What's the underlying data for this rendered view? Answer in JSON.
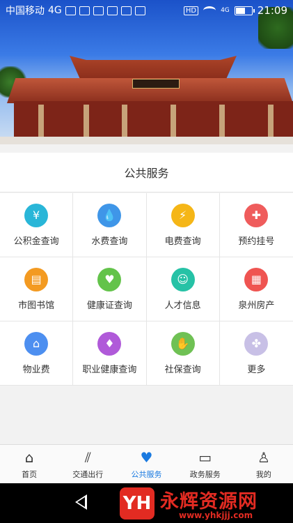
{
  "status_bar": {
    "carrier": "中国移动",
    "network": "4G",
    "hd": "HD",
    "signal_label": "4G",
    "time": "21:09"
  },
  "section": {
    "title": "公共服务"
  },
  "services": [
    {
      "label": "公积金查询",
      "icon": "house-yen-icon",
      "color": "#29b6d8",
      "glyph": "¥"
    },
    {
      "label": "水费查询",
      "icon": "water-drop-icon",
      "color": "#3f96e8",
      "glyph": "💧"
    },
    {
      "label": "电费查询",
      "icon": "lightning-icon",
      "color": "#f5b617",
      "glyph": "⚡"
    },
    {
      "label": "预约挂号",
      "icon": "doctor-icon",
      "color": "#ef5c5c",
      "glyph": "✚"
    },
    {
      "label": "市图书馆",
      "icon": "book-icon",
      "color": "#f39a21",
      "glyph": "▤"
    },
    {
      "label": "健康证查询",
      "icon": "heartbeat-icon",
      "color": "#63c34a",
      "glyph": "♥"
    },
    {
      "label": "人才信息",
      "icon": "people-icon",
      "color": "#26c2a6",
      "glyph": "☺"
    },
    {
      "label": "泉州房产",
      "icon": "building-icon",
      "color": "#ef5451",
      "glyph": "▦"
    },
    {
      "label": "物业费",
      "icon": "house-smile-icon",
      "color": "#4d8ff0",
      "glyph": "⌂"
    },
    {
      "label": "职业健康查询",
      "icon": "tie-icon",
      "color": "#b05ad9",
      "glyph": "♦"
    },
    {
      "label": "社保查询",
      "icon": "hands-icon",
      "color": "#6fc154",
      "glyph": "✋"
    },
    {
      "label": "更多",
      "icon": "more-icon",
      "color": "#c8c0e6",
      "glyph": "✤"
    }
  ],
  "tabs": [
    {
      "label": "首页",
      "icon": "home-icon",
      "glyph": "⌂",
      "active": false
    },
    {
      "label": "交通出行",
      "icon": "road-icon",
      "glyph": "⫽",
      "active": false
    },
    {
      "label": "公共服务",
      "icon": "heart-icon",
      "glyph": "♥",
      "active": true
    },
    {
      "label": "政务服务",
      "icon": "monitor-icon",
      "glyph": "▭",
      "active": false
    },
    {
      "label": "我的",
      "icon": "user-icon",
      "glyph": "♙",
      "active": false
    }
  ],
  "watermark": {
    "logo_text": "YH",
    "title": "永辉资源网",
    "url": "www.yhkjjj.com"
  },
  "colors": {
    "accent": "#1a7ae0",
    "watermark": "#e22b22"
  }
}
